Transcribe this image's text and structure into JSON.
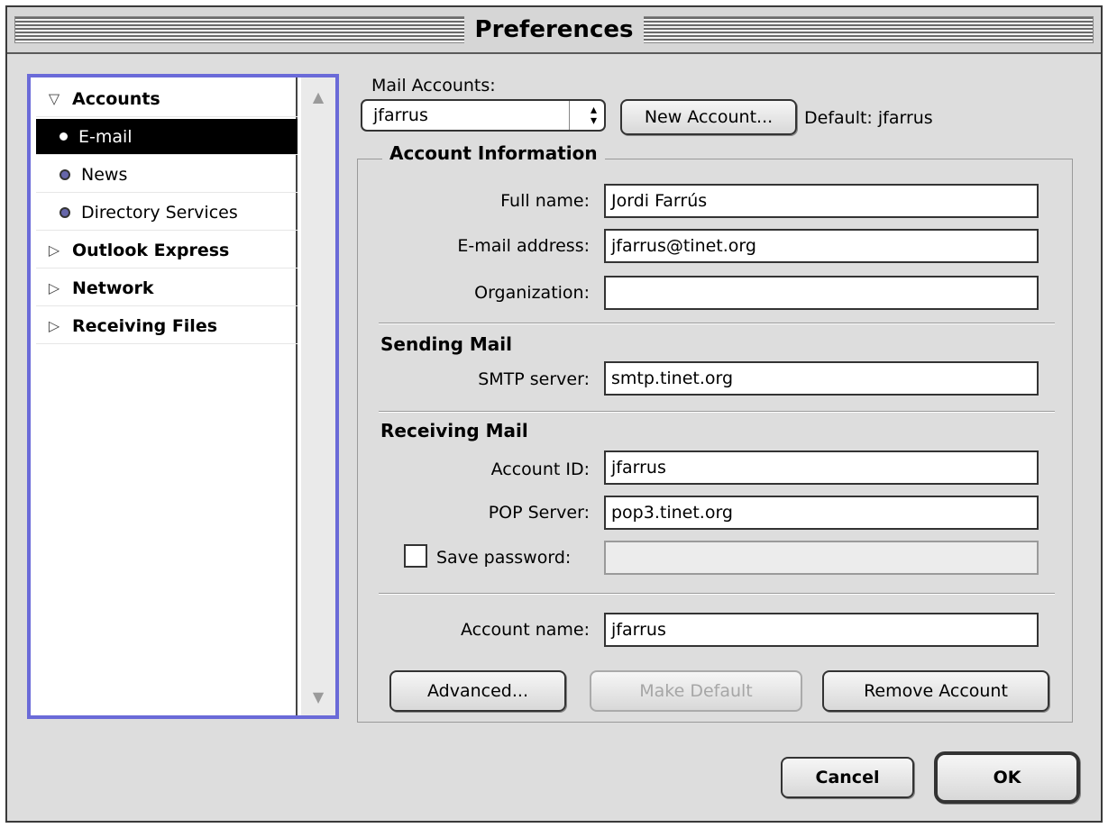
{
  "window": {
    "title": "Preferences"
  },
  "sidebar": {
    "items": [
      {
        "label": "Accounts",
        "kind": "group-open"
      },
      {
        "label": "E-mail",
        "kind": "item",
        "selected": true
      },
      {
        "label": "News",
        "kind": "item"
      },
      {
        "label": "Directory Services",
        "kind": "item"
      },
      {
        "label": "Outlook Express",
        "kind": "group-closed"
      },
      {
        "label": "Network",
        "kind": "group-closed"
      },
      {
        "label": "Receiving Files",
        "kind": "group-closed"
      }
    ]
  },
  "accounts": {
    "label": "Mail Accounts:",
    "selected": "jfarrus",
    "new_account_button": "New Account...",
    "default_text": "Default: jfarrus"
  },
  "account_info": {
    "title": "Account Information",
    "full_name_label": "Full name:",
    "full_name_value": "Jordi Farrús",
    "email_label": "E-mail address:",
    "email_value": "jfarrus@tinet.org",
    "organization_label": "Organization:",
    "organization_value": ""
  },
  "sending": {
    "title": "Sending Mail",
    "smtp_label": "SMTP server:",
    "smtp_value": "smtp.tinet.org"
  },
  "receiving": {
    "title": "Receiving Mail",
    "account_id_label": "Account ID:",
    "account_id_value": "jfarrus",
    "pop_label": "POP Server:",
    "pop_value": "pop3.tinet.org",
    "save_password_label": "Save password:",
    "save_password_checked": false,
    "password_value": ""
  },
  "account_name": {
    "label": "Account name:",
    "value": "jfarrus"
  },
  "buttons": {
    "advanced": "Advanced...",
    "make_default": "Make Default",
    "remove_account": "Remove Account",
    "cancel": "Cancel",
    "ok": "OK"
  },
  "colors": {
    "window_bg": "#dddddd",
    "sidebar_focus": "#6a6ad8",
    "selection": "#000000"
  }
}
